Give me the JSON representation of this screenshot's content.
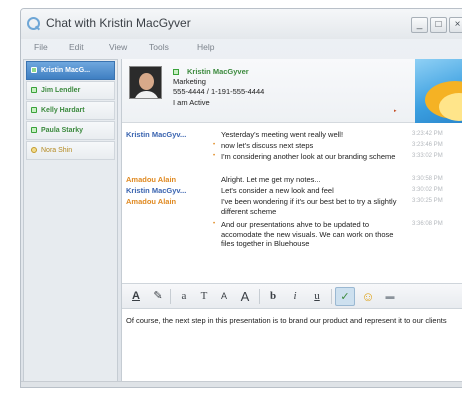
{
  "window": {
    "title": "Chat with Kristin MacGyver",
    "controls": {
      "minimize": "_",
      "maximize": "□",
      "close": "×"
    }
  },
  "menu": [
    "File",
    "Edit",
    "View",
    "Tools",
    "Help"
  ],
  "contacts": [
    {
      "name": "Kristin MacG...",
      "status": "online",
      "selected": true
    },
    {
      "name": "Jim Lendler",
      "status": "online",
      "selected": false
    },
    {
      "name": "Kelly Hardart",
      "status": "online",
      "selected": false
    },
    {
      "name": "Paula Starky",
      "status": "online",
      "selected": false
    },
    {
      "name": "Nora Shin",
      "status": "away",
      "selected": false
    }
  ],
  "profile": {
    "name": "Kristin MacGyver",
    "department": "Marketing",
    "phone": "555-4444 / 1-191-555-4444",
    "status": "I am Active",
    "marker": "▸"
  },
  "messages": [
    {
      "sender": "Kristin MacGyv...",
      "sender_type": "k",
      "bullet": "",
      "text": "Yesterday's meeting went really well!",
      "time": "3:23:42 PM"
    },
    {
      "sender": "",
      "sender_type": "k",
      "bullet": "•",
      "text": "now let's discuss next steps",
      "time": "3:23:46 PM"
    },
    {
      "sender": "",
      "sender_type": "k",
      "bullet": "•",
      "text": "I'm considering another look at our branding scheme",
      "time": "3:33:02 PM"
    },
    {
      "sender": "Amadou Alain",
      "sender_type": "a",
      "bullet": "",
      "text": "Alright. Let me get my notes...",
      "time": "3:30:58 PM"
    },
    {
      "sender": "Kristin MacGyv...",
      "sender_type": "k",
      "bullet": "",
      "text": "Let's consider a new look and feel",
      "time": "3:30:02 PM"
    },
    {
      "sender": "Amadou Alain",
      "sender_type": "a",
      "bullet": "",
      "text": "I've been wondering if it's our best bet to try a slightly different scheme",
      "time": "3:30:25 PM"
    },
    {
      "sender": "",
      "sender_type": "a",
      "bullet": "•",
      "text": "And our presentations ahve to be updated to accomodate the new visuals. We can work on those files together in Bluehouse",
      "time": "3:36:08 PM"
    }
  ],
  "toolbar": {
    "tools": [
      {
        "id": "underline-color",
        "glyph": "A̲",
        "icon": "text-color-icon"
      },
      {
        "id": "highlight",
        "glyph": "✎",
        "icon": "highlight-icon"
      },
      {
        "id": "font",
        "glyph": "a",
        "icon": "font-icon"
      },
      {
        "id": "text-size",
        "glyph": "T",
        "icon": "text-size-icon"
      },
      {
        "id": "shrink",
        "glyph": "A",
        "icon": "shrink-font-icon"
      },
      {
        "id": "grow",
        "glyph": "A",
        "icon": "grow-font-icon"
      },
      {
        "id": "bold",
        "glyph": "b",
        "icon": "bold-icon"
      },
      {
        "id": "italic",
        "glyph": "i",
        "icon": "italic-icon"
      },
      {
        "id": "underline",
        "glyph": "u",
        "icon": "underline-icon"
      },
      {
        "id": "spellcheck",
        "glyph": "✓",
        "icon": "spellcheck-icon"
      },
      {
        "id": "emoticon",
        "glyph": "☺",
        "icon": "emoticon-icon"
      },
      {
        "id": "more",
        "glyph": "▬",
        "icon": "more-icon"
      }
    ]
  },
  "compose": {
    "text": "Of course, the next step in this presentation is to brand our product and represent it to our clients"
  },
  "colors": {
    "accent": "#3f7fc2",
    "online": "#3c8a3e",
    "away": "#b48a21",
    "sender_self": "#3a64b0",
    "sender_other": "#e08a22"
  }
}
